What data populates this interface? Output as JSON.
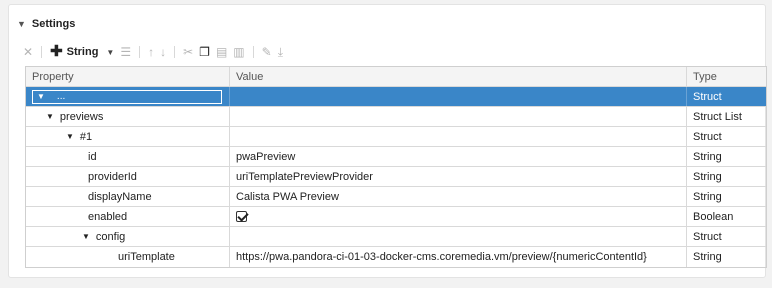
{
  "section": {
    "title": "Settings"
  },
  "toolbar": {
    "add_label": "String"
  },
  "columns": {
    "property": "Property",
    "value": "Value",
    "type": "Type"
  },
  "rows": [
    {
      "property": "...",
      "value": "",
      "type": "Struct"
    },
    {
      "property": "previews",
      "value": "",
      "type": "Struct List"
    },
    {
      "property": "#1",
      "value": "",
      "type": "Struct"
    },
    {
      "property": "id",
      "value": "pwaPreview",
      "type": "String"
    },
    {
      "property": "providerId",
      "value": "uriTemplatePreviewProvider",
      "type": "String"
    },
    {
      "property": "displayName",
      "value": "Calista PWA Preview",
      "type": "String"
    },
    {
      "property": "enabled",
      "value": true,
      "type": "Boolean"
    },
    {
      "property": "config",
      "value": "",
      "type": "Struct"
    },
    {
      "property": "uriTemplate",
      "value": "https://pwa.pandora-ci-01-03-docker-cms.coremedia.vm/preview/{numericContentId}",
      "type": "String"
    }
  ],
  "colors": {
    "selection": "#3a86c8",
    "panel_bg": "#ffffff",
    "page_bg": "#f2f2f2"
  }
}
